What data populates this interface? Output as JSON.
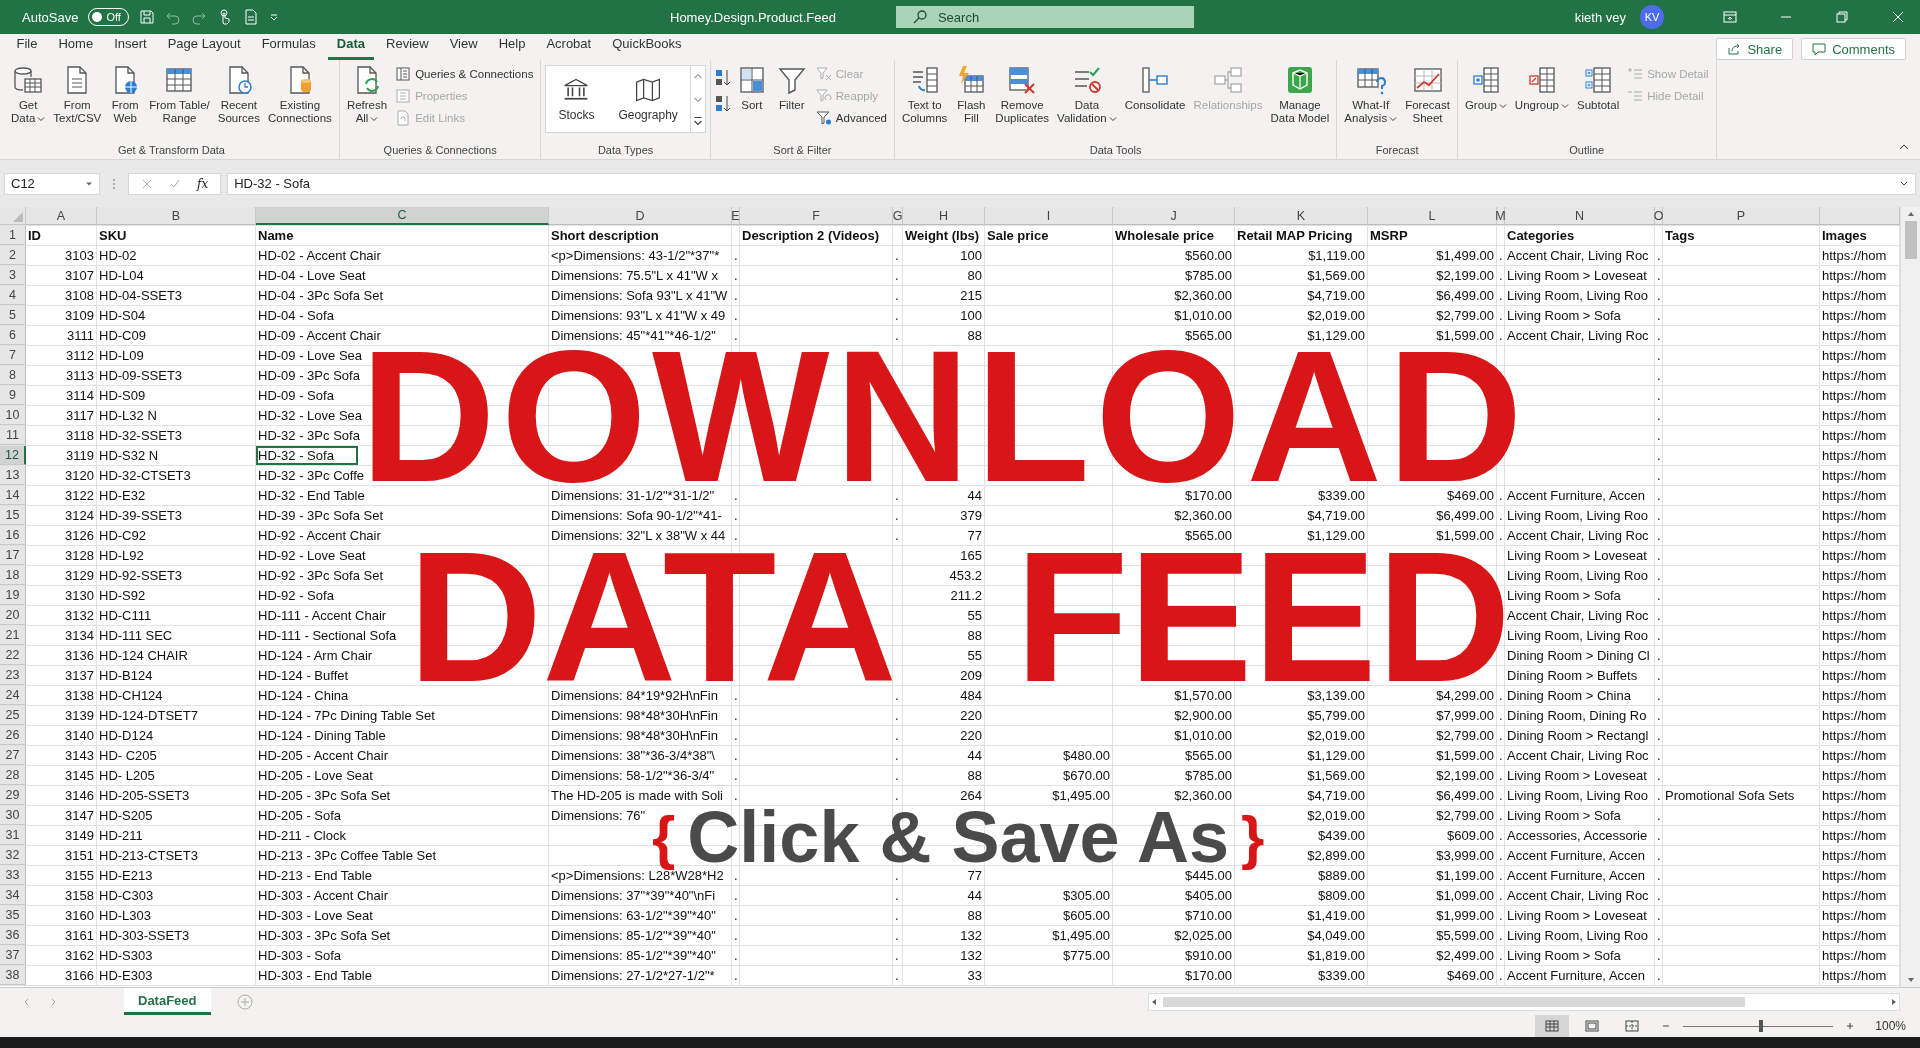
{
  "title_bar": {
    "autosave_label": "AutoSave",
    "autosave": {
      "on": false,
      "label": "Off"
    },
    "document_title": "Homey.Design.Product.Feed",
    "search_placeholder": "Search",
    "user_name": "kieth vey",
    "user_initials": "KV"
  },
  "menu_tabs": [
    {
      "label": "File",
      "selected": false
    },
    {
      "label": "Home",
      "selected": false
    },
    {
      "label": "Insert",
      "selected": false
    },
    {
      "label": "Page Layout",
      "selected": false
    },
    {
      "label": "Formulas",
      "selected": false
    },
    {
      "label": "Data",
      "selected": true
    },
    {
      "label": "Review",
      "selected": false
    },
    {
      "label": "View",
      "selected": false
    },
    {
      "label": "Help",
      "selected": false
    },
    {
      "label": "Acrobat",
      "selected": false
    },
    {
      "label": "QuickBooks",
      "selected": false
    }
  ],
  "share_button": "Share",
  "comments_button": "Comments",
  "ribbon": {
    "groups": [
      {
        "title": "Get & Transform Data",
        "items": [
          {
            "kind": "large",
            "lines": [
              "Get",
              "Data"
            ],
            "dropdown": true,
            "disabled": false
          },
          {
            "kind": "large",
            "lines": [
              "From",
              "Text/CSV"
            ],
            "dropdown": false,
            "disabled": false
          },
          {
            "kind": "large",
            "lines": [
              "From",
              "Web"
            ],
            "dropdown": false,
            "disabled": false
          },
          {
            "kind": "large",
            "lines": [
              "From Table/",
              "Range"
            ],
            "dropdown": false,
            "disabled": false
          },
          {
            "kind": "large",
            "lines": [
              "Recent",
              "Sources"
            ],
            "dropdown": false,
            "disabled": false
          },
          {
            "kind": "large",
            "lines": [
              "Existing",
              "Connections"
            ],
            "dropdown": false,
            "disabled": false
          }
        ]
      },
      {
        "title": "Queries & Connections",
        "items": [
          {
            "kind": "large",
            "lines": [
              "Refresh",
              "All"
            ],
            "dropdown": true,
            "disabled": false
          },
          {
            "kind": "stack",
            "items": [
              {
                "label": "Queries & Connections",
                "disabled": false
              },
              {
                "label": "Properties",
                "disabled": true
              },
              {
                "label": "Edit Links",
                "disabled": true
              }
            ]
          }
        ]
      },
      {
        "title": "Data Types",
        "items": [
          {
            "kind": "gallery",
            "items": [
              {
                "label": "Stocks"
              },
              {
                "label": "Geography"
              }
            ]
          }
        ]
      },
      {
        "title": "Sort & Filter",
        "items": [
          {
            "kind": "sort-buttons"
          },
          {
            "kind": "large",
            "lines": [
              "Sort"
            ],
            "dropdown": false,
            "disabled": false
          },
          {
            "kind": "large",
            "lines": [
              "Filter"
            ],
            "dropdown": false,
            "disabled": false
          },
          {
            "kind": "stack",
            "items": [
              {
                "label": "Clear",
                "disabled": true
              },
              {
                "label": "Reapply",
                "disabled": true
              },
              {
                "label": "Advanced",
                "disabled": false
              }
            ]
          }
        ]
      },
      {
        "title": "Data Tools",
        "items": [
          {
            "kind": "large",
            "lines": [
              "Text to",
              "Columns"
            ],
            "dropdown": false,
            "disabled": false
          },
          {
            "kind": "large",
            "lines": [
              "Flash",
              "Fill"
            ],
            "dropdown": false,
            "disabled": false
          },
          {
            "kind": "large",
            "lines": [
              "Remove",
              "Duplicates"
            ],
            "dropdown": false,
            "disabled": false
          },
          {
            "kind": "large",
            "lines": [
              "Data",
              "Validation"
            ],
            "dropdown": true,
            "disabled": false
          },
          {
            "kind": "large",
            "lines": [
              "Consolidate"
            ],
            "dropdown": false,
            "disabled": false
          },
          {
            "kind": "large",
            "lines": [
              "Relationships"
            ],
            "dropdown": false,
            "disabled": true
          },
          {
            "kind": "large",
            "lines": [
              "Manage",
              "Data Model"
            ],
            "dropdown": false,
            "disabled": false
          }
        ]
      },
      {
        "title": "Forecast",
        "items": [
          {
            "kind": "large",
            "lines": [
              "What-If",
              "Analysis"
            ],
            "dropdown": true,
            "disabled": false
          },
          {
            "kind": "large",
            "lines": [
              "Forecast",
              "Sheet"
            ],
            "dropdown": false,
            "disabled": false
          }
        ]
      },
      {
        "title": "Outline",
        "items": [
          {
            "kind": "large",
            "lines": [
              "Group"
            ],
            "dropdown": true,
            "disabled": false
          },
          {
            "kind": "large",
            "lines": [
              "Ungroup"
            ],
            "dropdown": true,
            "disabled": false
          },
          {
            "kind": "large",
            "lines": [
              "Subtotal"
            ],
            "dropdown": false,
            "disabled": false
          },
          {
            "kind": "stack",
            "items": [
              {
                "label": "Show Detail",
                "disabled": true
              },
              {
                "label": "Hide Detail",
                "disabled": true
              }
            ]
          }
        ]
      }
    ]
  },
  "formula_bar": {
    "name_box": "C12",
    "fx": "fx",
    "formula": "HD-32 - Sofa"
  },
  "table": {
    "columns": [
      {
        "letter": "A",
        "kind": "number",
        "selected": false
      },
      {
        "letter": "B",
        "kind": "text",
        "selected": false
      },
      {
        "letter": "C",
        "kind": "text",
        "selected": true
      },
      {
        "letter": "D",
        "kind": "text",
        "selected": false
      },
      {
        "letter": "E",
        "kind": "text",
        "selected": false
      },
      {
        "letter": "F",
        "kind": "text",
        "selected": false
      },
      {
        "letter": "G",
        "kind": "text",
        "selected": false
      },
      {
        "letter": "H",
        "kind": "number",
        "selected": false
      },
      {
        "letter": "I",
        "kind": "number",
        "selected": false
      },
      {
        "letter": "J",
        "kind": "number",
        "selected": false
      },
      {
        "letter": "K",
        "kind": "number",
        "selected": false
      },
      {
        "letter": "L",
        "kind": "number",
        "selected": false
      },
      {
        "letter": "M",
        "kind": "text",
        "selected": false
      },
      {
        "letter": "N",
        "kind": "text",
        "selected": false
      },
      {
        "letter": "O",
        "kind": "text",
        "selected": false
      },
      {
        "letter": "P",
        "kind": "text",
        "selected": false
      },
      {
        "kind": "text",
        "selected": false
      }
    ],
    "header": {
      "number": "1",
      "selected": false,
      "cells": [
        "ID",
        "SKU",
        "Name",
        "Short description",
        null,
        "Description 2 (Videos)",
        null,
        "Weight (lbs)",
        "Sale price",
        "Wholesale price",
        "Retail MAP Pricing",
        "MSRP",
        null,
        "Categories",
        null,
        "Tags",
        "Images"
      ]
    },
    "rows": [
      {
        "number": "2",
        "selected": false,
        "cells": [
          "3103",
          "HD-02",
          "HD-02 - Accent Chair",
          "<p>Dimensions: 43-1/2\"*37\"*",
          ".",
          null,
          ".",
          "100",
          null,
          "$560.00",
          "$1,119.00",
          "$1,499.00",
          ".",
          "Accent Chair, Living Roc",
          ".",
          null,
          "https://hom"
        ]
      },
      {
        "number": "3",
        "selected": false,
        "cells": [
          "3107",
          "HD-L04",
          "HD-04 - Love Seat",
          "Dimensions: 75.5\"L x 41\"W x",
          ".",
          null,
          ".",
          "80",
          null,
          "$785.00",
          "$1,569.00",
          "$2,199.00",
          ".",
          "Living Room > Loveseat",
          ".",
          null,
          "https://hom"
        ]
      },
      {
        "number": "4",
        "selected": false,
        "cells": [
          "3108",
          "HD-04-SSET3",
          "HD-04 - 3Pc Sofa Set",
          "Dimensions: Sofa 93\"L x 41\"W",
          ".",
          null,
          ".",
          "215",
          null,
          "$2,360.00",
          "$4,719.00",
          "$6,499.00",
          ".",
          "Living Room, Living Roo",
          ".",
          null,
          "https://hom"
        ]
      },
      {
        "number": "5",
        "selected": false,
        "cells": [
          "3109",
          "HD-S04",
          "HD-04 - Sofa",
          "Dimensions: 93\"L x 41\"W x 49",
          ".",
          null,
          ".",
          "100",
          null,
          "$1,010.00",
          "$2,019.00",
          "$2,799.00",
          ".",
          "Living Room > Sofa",
          ".",
          null,
          "https://hom"
        ]
      },
      {
        "number": "6",
        "selected": false,
        "cells": [
          "3111",
          "HD-C09",
          "HD-09 - Accent Chair",
          "Dimensions: 45\"*41\"*46-1/2\"",
          ".",
          null,
          ".",
          "88",
          null,
          "$565.00",
          "$1,129.00",
          "$1,599.00",
          ".",
          "Accent Chair, Living Roc",
          ".",
          null,
          "https://hom"
        ]
      },
      {
        "number": "7",
        "selected": false,
        "cells": [
          "3112",
          "HD-L09",
          "HD-09 - Love Sea",
          null,
          null,
          null,
          null,
          null,
          null,
          null,
          null,
          null,
          null,
          null,
          ".",
          null,
          "https://hom"
        ]
      },
      {
        "number": "8",
        "selected": false,
        "cells": [
          "3113",
          "HD-09-SSET3",
          "HD-09 - 3Pc Sofa",
          null,
          null,
          null,
          null,
          null,
          null,
          null,
          null,
          null,
          null,
          null,
          ".",
          null,
          "https://hom"
        ]
      },
      {
        "number": "9",
        "selected": false,
        "cells": [
          "3114",
          "HD-S09",
          "HD-09 - Sofa",
          null,
          null,
          null,
          null,
          null,
          null,
          null,
          null,
          null,
          null,
          null,
          ".",
          null,
          "https://hom"
        ]
      },
      {
        "number": "10",
        "selected": false,
        "cells": [
          "3117",
          "HD-L32 N",
          "HD-32 - Love Sea",
          null,
          null,
          null,
          null,
          null,
          null,
          null,
          null,
          null,
          null,
          null,
          ".",
          null,
          "https://hom"
        ]
      },
      {
        "number": "11",
        "selected": false,
        "cells": [
          "3118",
          "HD-32-SSET3",
          "HD-32 - 3Pc Sofa",
          null,
          null,
          null,
          null,
          null,
          null,
          null,
          null,
          null,
          null,
          null,
          ".",
          null,
          "https://hom"
        ]
      },
      {
        "number": "12",
        "selected": true,
        "cells": [
          "3119",
          "HD-S32 N",
          "HD-32 - Sofa",
          null,
          null,
          null,
          null,
          null,
          null,
          null,
          null,
          null,
          null,
          null,
          ".",
          null,
          "https://hom"
        ]
      },
      {
        "number": "13",
        "selected": false,
        "cells": [
          "3120",
          "HD-32-CTSET3",
          "HD-32 - 3Pc Coffe",
          null,
          null,
          null,
          null,
          null,
          null,
          null,
          null,
          null,
          null,
          null,
          ".",
          null,
          "https://hom"
        ]
      },
      {
        "number": "14",
        "selected": false,
        "cells": [
          "3122",
          "HD-E32",
          "HD-32 - End Table",
          "Dimensions: 31-1/2\"*31-1/2\"",
          ".",
          null,
          ".",
          "44",
          null,
          "$170.00",
          "$339.00",
          "$469.00",
          ".",
          "Accent Furniture, Accen",
          ".",
          null,
          "https://hom"
        ]
      },
      {
        "number": "15",
        "selected": false,
        "cells": [
          "3124",
          "HD-39-SSET3",
          "HD-39 - 3Pc Sofa Set",
          "Dimensions: Sofa 90-1/2\"*41-",
          ".",
          null,
          ".",
          "379",
          null,
          "$2,360.00",
          "$4,719.00",
          "$6,499.00",
          ".",
          "Living Room, Living Roo",
          ".",
          null,
          "https://hom"
        ]
      },
      {
        "number": "16",
        "selected": false,
        "cells": [
          "3126",
          "HD-C92",
          "HD-92 - Accent Chair",
          "Dimensions: 32\"L x 38\"W x 44",
          ".",
          null,
          ".",
          "77",
          null,
          "$565.00",
          "$1,129.00",
          "$1,599.00",
          ".",
          "Accent Chair, Living Roc",
          ".",
          null,
          "https://hom"
        ]
      },
      {
        "number": "17",
        "selected": false,
        "cells": [
          "3128",
          "HD-L92",
          "HD-92 - Love Seat",
          null,
          null,
          null,
          null,
          "165",
          null,
          null,
          null,
          null,
          null,
          "Living Room > Loveseat",
          ".",
          null,
          "https://hom"
        ]
      },
      {
        "number": "18",
        "selected": false,
        "cells": [
          "3129",
          "HD-92-SSET3",
          "HD-92 - 3Pc Sofa Set",
          null,
          null,
          null,
          null,
          "453.2",
          null,
          null,
          null,
          null,
          null,
          "Living Room, Living Roo",
          ".",
          null,
          "https://hom"
        ]
      },
      {
        "number": "19",
        "selected": false,
        "cells": [
          "3130",
          "HD-S92",
          "HD-92 - Sofa",
          null,
          null,
          null,
          null,
          "211.2",
          null,
          null,
          null,
          null,
          null,
          "Living Room > Sofa",
          ".",
          null,
          "https://hom"
        ]
      },
      {
        "number": "20",
        "selected": false,
        "cells": [
          "3132",
          "HD-C111",
          "HD-111 - Accent Chair",
          null,
          null,
          null,
          null,
          "55",
          null,
          null,
          null,
          null,
          null,
          "Accent Chair, Living Roc",
          ".",
          null,
          "https://hom"
        ]
      },
      {
        "number": "21",
        "selected": false,
        "cells": [
          "3134",
          "HD-111 SEC",
          "HD-111 - Sectional Sofa",
          null,
          null,
          null,
          null,
          "88",
          null,
          null,
          null,
          null,
          null,
          "Living Room, Living Roo",
          ".",
          null,
          "https://hom"
        ]
      },
      {
        "number": "22",
        "selected": false,
        "cells": [
          "3136",
          "HD-124 CHAIR",
          "HD-124 - Arm Chair",
          null,
          null,
          null,
          null,
          "55",
          null,
          null,
          null,
          null,
          null,
          "Dining Room > Dining Cl",
          ".",
          null,
          "https://hom"
        ]
      },
      {
        "number": "23",
        "selected": false,
        "cells": [
          "3137",
          "HD-B124",
          "HD-124 - Buffet",
          null,
          null,
          null,
          null,
          "209",
          null,
          null,
          null,
          null,
          null,
          "Dining Room > Buffets",
          ".",
          null,
          "https://hom"
        ]
      },
      {
        "number": "24",
        "selected": false,
        "cells": [
          "3138",
          "HD-CH124",
          "HD-124 - China",
          "Dimensions: 84*19*92H\\nFin",
          ".",
          null,
          ".",
          "484",
          null,
          "$1,570.00",
          "$3,139.00",
          "$4,299.00",
          ".",
          "Dining Room > China",
          ".",
          null,
          "https://hom"
        ]
      },
      {
        "number": "25",
        "selected": false,
        "cells": [
          "3139",
          "HD-124-DTSET7",
          "HD-124 - 7Pc Dining Table Set",
          "Dimensions: 98*48*30H\\nFin",
          ".",
          null,
          ".",
          "220",
          null,
          "$2,900.00",
          "$5,799.00",
          "$7,999.00",
          ".",
          "Dining Room, Dining Ro",
          ".",
          null,
          "https://hom"
        ]
      },
      {
        "number": "26",
        "selected": false,
        "cells": [
          "3140",
          "HD-D124",
          "HD-124 - Dining Table",
          "Dimensions: 98*48*30H\\nFin",
          ".",
          null,
          ".",
          "220",
          null,
          "$1,010.00",
          "$2,019.00",
          "$2,799.00",
          ".",
          "Dining Room > Rectangl",
          ".",
          null,
          "https://hom"
        ]
      },
      {
        "number": "27",
        "selected": false,
        "cells": [
          "3143",
          "HD- C205",
          "HD-205 - Accent Chair",
          "Dimensions: 38\"*36-3/4*38\"\\",
          ".",
          null,
          ".",
          "44",
          "$480.00",
          "$565.00",
          "$1,129.00",
          "$1,599.00",
          ".",
          "Accent Chair, Living Roc",
          ".",
          null,
          "https://hom"
        ]
      },
      {
        "number": "28",
        "selected": false,
        "cells": [
          "3145",
          "HD- L205",
          "HD-205 - Love Seat",
          "Dimensions: 58-1/2\"*36-3/4\"",
          ".",
          null,
          ".",
          "88",
          "$670.00",
          "$785.00",
          "$1,569.00",
          "$2,199.00",
          ".",
          "Living Room > Loveseat",
          ".",
          null,
          "https://hom"
        ]
      },
      {
        "number": "29",
        "selected": false,
        "cells": [
          "3146",
          "HD-205-SSET3",
          "HD-205 - 3Pc Sofa Set",
          "The HD-205 is made with Soli",
          ".",
          null,
          ".",
          "264",
          "$1,495.00",
          "$2,360.00",
          "$4,719.00",
          "$6,499.00",
          ".",
          "Living Room, Living Roo",
          ".",
          "Promotional Sofa Sets",
          "https://hom"
        ]
      },
      {
        "number": "30",
        "selected": false,
        "cells": [
          "3147",
          "HD-S205",
          "HD-205 - Sofa",
          "Dimensions: 76\"",
          null,
          null,
          null,
          null,
          null,
          null,
          "$2,019.00",
          "$2,799.00",
          ".",
          "Living Room > Sofa",
          ".",
          null,
          "https://hom"
        ]
      },
      {
        "number": "31",
        "selected": false,
        "cells": [
          "3149",
          "HD-211",
          "HD-211 - Clock",
          null,
          null,
          null,
          null,
          null,
          null,
          null,
          "$439.00",
          "$609.00",
          ".",
          "Accessories, Accessorie",
          ".",
          null,
          "https://hom"
        ]
      },
      {
        "number": "32",
        "selected": false,
        "cells": [
          "3151",
          "HD-213-CTSET3",
          "HD-213 - 3Pc Coffee Table Set",
          null,
          null,
          null,
          null,
          null,
          null,
          null,
          "$2,899.00",
          "$3,999.00",
          ".",
          "Accent Furniture, Accen",
          ".",
          null,
          "https://hom"
        ]
      },
      {
        "number": "33",
        "selected": false,
        "cells": [
          "3155",
          "HD-E213",
          "HD-213 - End Table",
          "<p>Dimensions: L28*W28*H2",
          ".",
          null,
          ".",
          "77",
          null,
          "$445.00",
          "$889.00",
          "$1,199.00",
          ".",
          "Accent Furniture, Accen",
          ".",
          null,
          "https://hom"
        ]
      },
      {
        "number": "34",
        "selected": false,
        "cells": [
          "3158",
          "HD-C303",
          "HD-303 - Accent Chair",
          "Dimensions: 37\"*39\"*40\"\\nFi",
          ".",
          null,
          ".",
          "44",
          "$305.00",
          "$405.00",
          "$809.00",
          "$1,099.00",
          ".",
          "Accent Chair, Living Roc",
          ".",
          null,
          "https://hom"
        ]
      },
      {
        "number": "35",
        "selected": false,
        "cells": [
          "3160",
          "HD-L303",
          "HD-303 - Love Seat",
          "Dimensions: 63-1/2\"*39\"*40\"",
          ".",
          null,
          ".",
          "88",
          "$605.00",
          "$710.00",
          "$1,419.00",
          "$1,999.00",
          ".",
          "Living Room > Loveseat",
          ".",
          null,
          "https://hom"
        ]
      },
      {
        "number": "36",
        "selected": false,
        "cells": [
          "3161",
          "HD-303-SSET3",
          "HD-303 - 3Pc Sofa Set",
          "Dimensions: 85-1/2\"*39\"*40\"",
          ".",
          null,
          ".",
          "132",
          "$1,495.00",
          "$2,025.00",
          "$4,049.00",
          "$5,599.00",
          ".",
          "Living Room, Living Roo",
          ".",
          null,
          "https://hom"
        ]
      },
      {
        "number": "37",
        "selected": false,
        "cells": [
          "3162",
          "HD-S303",
          "HD-303 - Sofa",
          "Dimensions: 85-1/2\"*39\"*40\"",
          ".",
          null,
          ".",
          "132",
          "$775.00",
          "$910.00",
          "$1,819.00",
          "$2,499.00",
          ".",
          "Living Room > Sofa",
          ".",
          null,
          "https://hom"
        ]
      },
      {
        "number": "38",
        "selected": false,
        "cells": [
          "3166",
          "HD-E303",
          "HD-303 - End Table",
          "Dimensions: 27-1/2*27-1/2\"*",
          ".",
          null,
          ".",
          "33",
          null,
          "$170.00",
          "$339.00",
          "$469.00",
          ".",
          "Accent Furniture, Accen",
          ".",
          null,
          "https://hom"
        ]
      }
    ]
  },
  "overlay": {
    "headline": "DOWNLOAD",
    "words": [
      "DATA",
      "FEED"
    ],
    "open_brace": "{",
    "action": "Click & Save As",
    "close_brace": "}"
  },
  "sheet_tabs": [
    {
      "label": "DataFeed",
      "selected": true
    }
  ],
  "status_bar": {
    "views": [
      {
        "selected": true
      },
      {
        "selected": false
      },
      {
        "selected": false
      }
    ],
    "zoom": {
      "level": 0.52,
      "reading": "100%"
    }
  }
}
